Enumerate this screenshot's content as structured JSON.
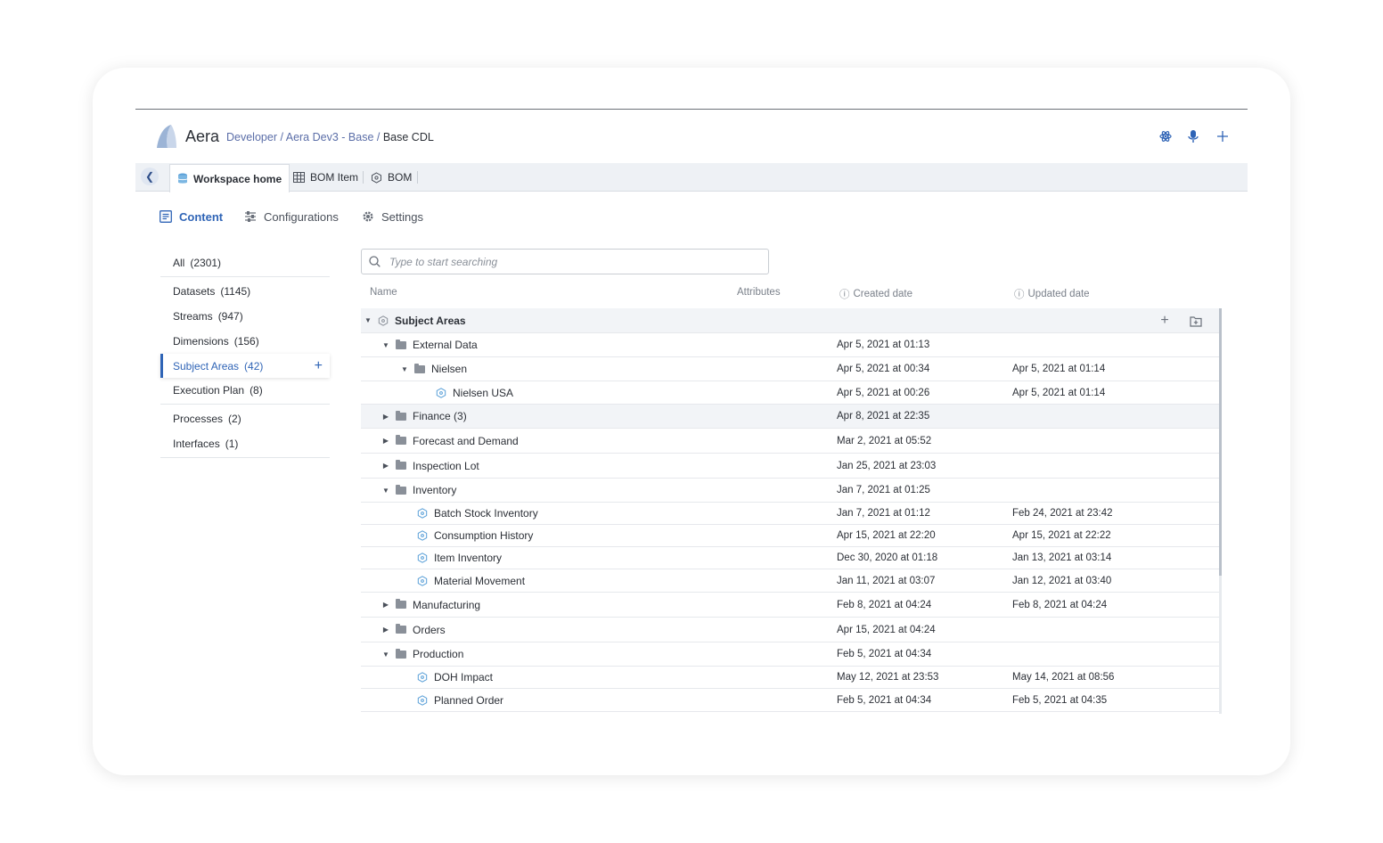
{
  "header": {
    "brand": "Aera",
    "breadcrumb": [
      {
        "label": "Developer"
      },
      {
        "label": "Aera Dev3 - Base"
      },
      {
        "label": "Base CDL"
      }
    ]
  },
  "tabs": [
    {
      "label": "Workspace home",
      "icon": "database-icon",
      "active": true
    },
    {
      "label": "BOM Item",
      "icon": "table-icon",
      "active": false
    },
    {
      "label": "BOM",
      "icon": "hexagon-icon",
      "active": false
    }
  ],
  "subnav": [
    {
      "label": "Content",
      "icon": "content-icon",
      "active": true
    },
    {
      "label": "Configurations",
      "icon": "sliders-icon",
      "active": false
    },
    {
      "label": "Settings",
      "icon": "gear-icon",
      "active": false
    }
  ],
  "sidebar": {
    "items": [
      {
        "label": "All",
        "count": "(2301)"
      },
      {
        "label": "Datasets",
        "count": "(1145)"
      },
      {
        "label": "Streams",
        "count": "(947)"
      },
      {
        "label": "Dimensions",
        "count": "(156)"
      },
      {
        "label": "Subject Areas",
        "count": "(42)",
        "active": true
      },
      {
        "label": "Execution Plan",
        "count": "(8)"
      },
      {
        "label": "Processes",
        "count": "(2)"
      },
      {
        "label": "Interfaces",
        "count": "(1)"
      }
    ]
  },
  "search": {
    "placeholder": "Type to start searching"
  },
  "table": {
    "columns": {
      "name": "Name",
      "attributes": "Attributes",
      "created": "Created date",
      "updated": "Updated date"
    },
    "root": {
      "name": "Subject Areas"
    },
    "rows": [
      {
        "name": "External Data",
        "created": "Apr 5, 2021 at 01:13",
        "updated": ""
      },
      {
        "name": "Nielsen",
        "created": "Apr 5, 2021 at 00:34",
        "updated": "Apr 5, 2021 at 01:14"
      },
      {
        "name": "Nielsen USA",
        "created": "Apr 5, 2021 at 00:26",
        "updated": "Apr 5, 2021 at 01:14"
      },
      {
        "name": "Finance (3)",
        "created": "Apr 8, 2021 at 22:35",
        "updated": ""
      },
      {
        "name": "Forecast and Demand",
        "created": "Mar 2, 2021 at 05:52",
        "updated": ""
      },
      {
        "name": "Inspection Lot",
        "created": "Jan 25, 2021 at 23:03",
        "updated": ""
      },
      {
        "name": "Inventory",
        "created": "Jan 7, 2021 at 01:25",
        "updated": ""
      },
      {
        "name": "Batch Stock Inventory",
        "created": "Jan 7, 2021 at 01:12",
        "updated": "Feb 24, 2021 at 23:42"
      },
      {
        "name": "Consumption History",
        "created": "Apr 15, 2021 at 22:20",
        "updated": "Apr 15, 2021 at 22:22"
      },
      {
        "name": "Item Inventory",
        "created": "Dec 30, 2020 at 01:18",
        "updated": "Jan 13, 2021 at 03:14"
      },
      {
        "name": "Material Movement",
        "created": "Jan 11, 2021 at 03:07",
        "updated": "Jan 12, 2021 at 03:40"
      },
      {
        "name": "Manufacturing",
        "created": "Feb 8, 2021 at 04:24",
        "updated": "Feb 8, 2021 at 04:24"
      },
      {
        "name": "Orders",
        "created": "Apr 15, 2021 at 04:24",
        "updated": ""
      },
      {
        "name": "Production",
        "created": "Feb 5, 2021 at 04:34",
        "updated": ""
      },
      {
        "name": "DOH Impact",
        "created": "May 12, 2021 at 23:53",
        "updated": "May 14, 2021 at 08:56"
      },
      {
        "name": "Planned Order",
        "created": "Feb 5, 2021 at 04:34",
        "updated": "Feb 5, 2021 at 04:35"
      }
    ]
  },
  "colors": {
    "accent": "#2f64b6",
    "hex_icon": "#5aa0d8"
  }
}
